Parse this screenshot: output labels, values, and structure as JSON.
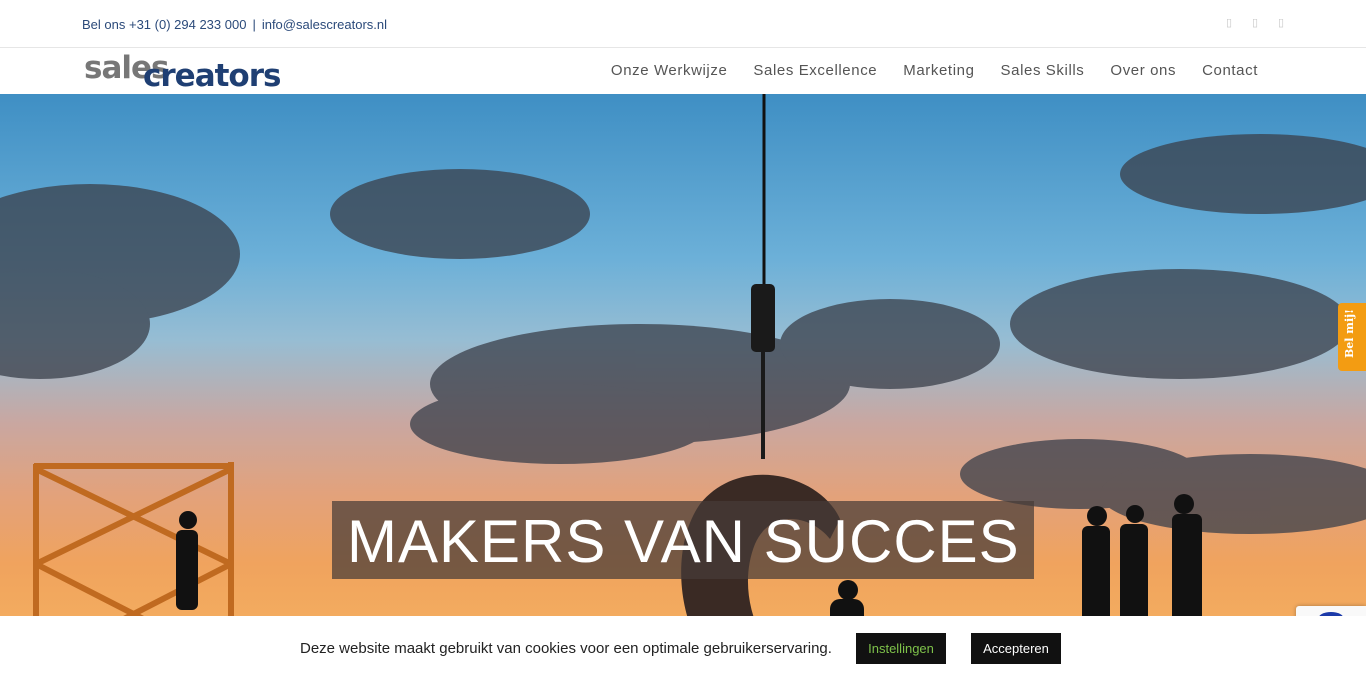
{
  "topbar": {
    "phone": "Bel ons +31 (0) 294 233 000",
    "separator": "|",
    "email": "info@salescreators.nl",
    "social_icons": [
      "facebook-icon",
      "twitter-icon",
      "linkedin-icon"
    ]
  },
  "logo": {
    "part1": "sales",
    "part2": "creators"
  },
  "nav": {
    "items": [
      {
        "label": "Onze Werkwijze"
      },
      {
        "label": "Sales Excellence"
      },
      {
        "label": "Marketing"
      },
      {
        "label": "Sales Skills"
      },
      {
        "label": "Over ons"
      },
      {
        "label": "Contact"
      }
    ]
  },
  "hero": {
    "headline": "MAKERS VAN SUCCES"
  },
  "side_tab": {
    "label": "Bel mij!"
  },
  "cookie": {
    "message": "Deze website maakt gebruikt van cookies voor een optimale gebruikerservaring.",
    "settings_label": "Instellingen",
    "accept_label": "Accepteren"
  },
  "colors": {
    "brand_blue": "#1f3f73",
    "accent_orange": "#f39c12",
    "settings_green": "#7ec24a"
  }
}
